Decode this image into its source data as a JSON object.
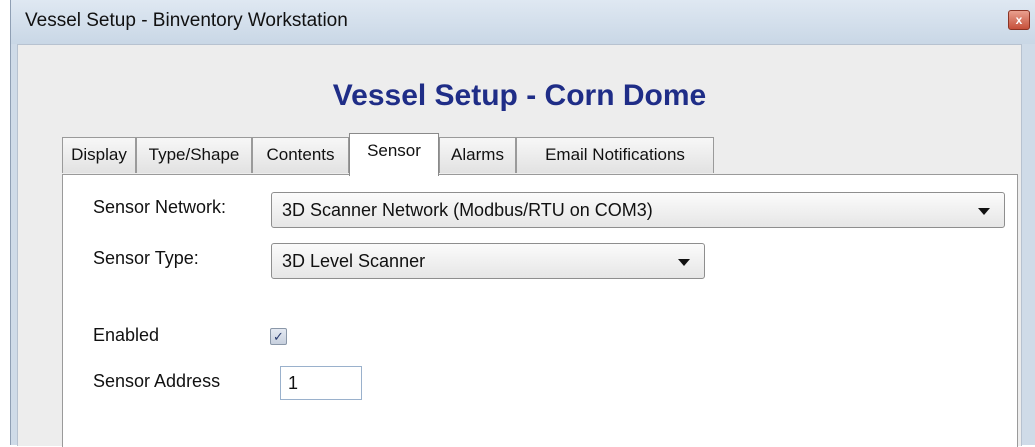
{
  "window": {
    "title": "Vessel Setup - Binventory Workstation",
    "close_glyph": "x"
  },
  "heading": "Vessel Setup - Corn Dome",
  "tabs": [
    {
      "label": "Display",
      "active": false
    },
    {
      "label": "Type/Shape",
      "active": false
    },
    {
      "label": "Contents",
      "active": false
    },
    {
      "label": "Sensor",
      "active": true
    },
    {
      "label": "Alarms",
      "active": false
    },
    {
      "label": "Email Notifications",
      "active": false
    }
  ],
  "sensor": {
    "network_label": "Sensor Network:",
    "network_value": "3D Scanner Network (Modbus/RTU on COM3)",
    "type_label": "Sensor Type:",
    "type_value": "3D Level Scanner",
    "enabled_label": "Enabled",
    "enabled_checked": true,
    "check_glyph": "✓",
    "address_label": "Sensor Address",
    "address_value": "1"
  },
  "colors": {
    "heading": "#1f2d87",
    "window_frame": "#cfdbe8",
    "close_button": "#c6503a"
  }
}
